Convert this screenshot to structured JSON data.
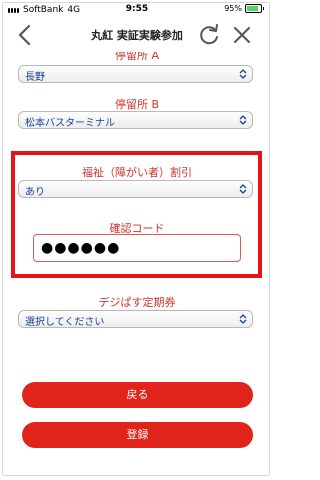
{
  "status_bar": {
    "carrier": "SoftBank",
    "network": "4G",
    "time": "9:55",
    "battery": "95%"
  },
  "nav": {
    "title": "丸紅 実証実験参加"
  },
  "form": {
    "stop_a": {
      "label": "停留所 A",
      "value": "長野"
    },
    "stop_b": {
      "label": "停留所 B",
      "value": "松本バスターミナル"
    },
    "welfare": {
      "label": "福祉（障がい者）割引",
      "value": "あり"
    },
    "code": {
      "label": "確認コード",
      "value": "●●●●●●"
    },
    "pass": {
      "label": "デジぱす定期券",
      "value": "選択してください"
    }
  },
  "buttons": {
    "back": "戻る",
    "register": "登録"
  },
  "colors": {
    "accent": "#e0241c",
    "highlight": "#e3151a",
    "select_text": "#1a3f9a"
  },
  "icons": [
    "back-chevron-icon",
    "reload-icon",
    "close-icon",
    "select-caret-icon"
  ]
}
